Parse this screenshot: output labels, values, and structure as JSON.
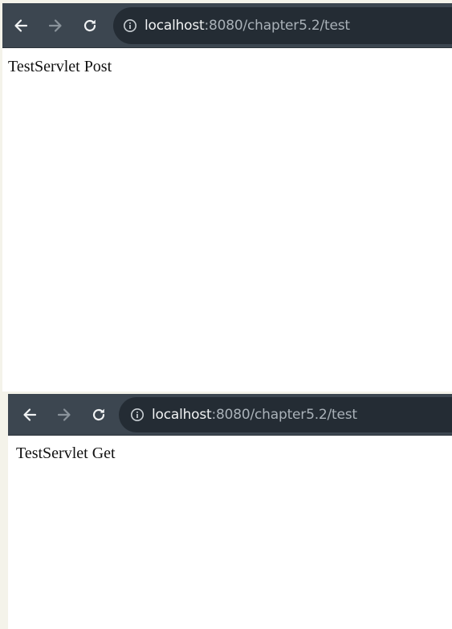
{
  "windows": [
    {
      "url": {
        "host": "localhost",
        "rest": ":8080/chapter5.2/test"
      },
      "page_text": "TestServlet Post"
    },
    {
      "url": {
        "host": "localhost",
        "rest": ":8080/chapter5.2/test"
      },
      "page_text": "TestServlet Get"
    }
  ],
  "icons": {
    "back": "back-arrow-icon",
    "forward": "forward-arrow-icon",
    "reload": "reload-icon",
    "info": "info-circle-icon"
  },
  "colors": {
    "toolbar": "#3c4650",
    "omnibox": "#242c34",
    "host_text": "#f1f3f4",
    "path_text": "#a9b1b8",
    "page_background": "#ffffff",
    "surround": "#f4f3ea"
  }
}
